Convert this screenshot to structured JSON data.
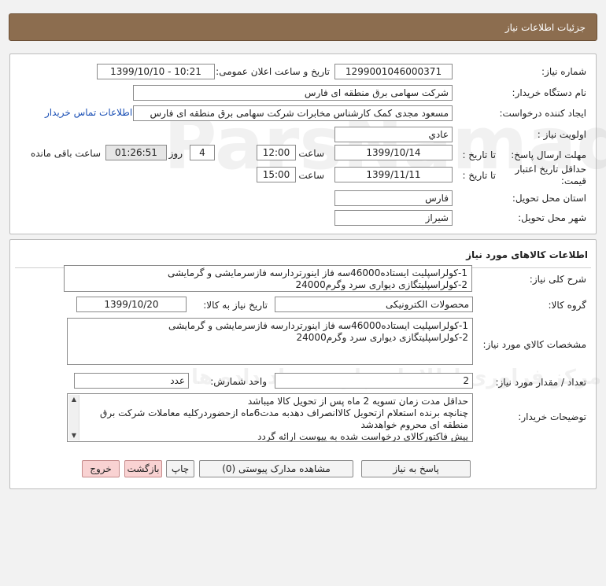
{
  "header": {
    "title": "جزئیات اطلاعات نیاز"
  },
  "info": {
    "need_number_label": "شماره نیاز:",
    "need_number": "1299001046000371",
    "announce_label": "تاریخ و ساعت اعلان عمومی:",
    "announce_value": "1399/10/10 - 10:21",
    "buyer_org_label": "نام دستگاه خریدار:",
    "buyer_org": "شرکت سهامی برق منطقه ای فارس",
    "creator_label": "ایجاد کننده درخواست:",
    "creator": "مسعود مجدی کمک کارشناس مخابرات شرکت سهامی برق منطقه ای فارس",
    "contact_link": "اطلاعات تماس خریدار",
    "priority_label": "اولویت نیاز :",
    "priority": "عادي",
    "deadline_label": "مهلت ارسال پاسخ:",
    "to_date_label": "تا تاریخ :",
    "deadline_date": "1399/10/14",
    "time_label": "ساعت",
    "deadline_time": "12:00",
    "days_value": "4",
    "days_label": "روز و",
    "remaining_time": "01:26:51",
    "remaining_label": "ساعت باقی مانده",
    "validity_label": "حداقل تاریخ اعتبار قیمت:",
    "validity_to_date_label": "تا تاریخ :",
    "validity_date": "1399/11/11",
    "validity_time_label": "ساعت",
    "validity_time": "15:00",
    "province_label": "استان محل تحویل:",
    "province": "فارس",
    "city_label": "شهر محل تحویل:",
    "city": "شیراز"
  },
  "goods": {
    "section_title": "اطلاعات کالاهای مورد نیاز",
    "summary_label": "شرح کلی نیاز:",
    "summary_lines": [
      "1-کولراسپلیت ایستاده46000سه فاز اینورتردارسه فازسرمایشی و گرمایشی",
      "2-کولراسپلیتگازی دیواری سرد وگرم24000"
    ],
    "group_label": "گروه کالا:",
    "group_value": "محصولات الکترونیکی",
    "need_date_label": "تاریخ نیاز به کالا:",
    "need_date": "1399/10/20",
    "specs_label": "مشخصات کالاي مورد نیاز:",
    "specs_lines": [
      "1-کولراسپلیت ایستاده46000سه فاز اینورتردارسه فازسرمایشی و گرمایشی",
      "2-کولراسپلیتگازی دیواری سرد وگرم24000"
    ],
    "qty_label": "تعداد / مقدار مورد نیاز:",
    "qty": "2",
    "unit_label": "واحد شمارش:",
    "unit": "عدد",
    "buyer_notes_label": "توضیحات خریدار:",
    "buyer_notes_lines": [
      "حداقل مدت زمان تسویه 2 ماه پس از تحویل کالا میباشد",
      "چنانچه برنده استعلام ازتحویل کالاانصراف دهدبه مدت6ماه ازحضوردرکلیه معاملات شرکت برق",
      "منطقه ای محروم خواهدشد",
      "پیش فاکتورکالای درخواست شده به پیوست ارائه گردد"
    ]
  },
  "buttons": {
    "reply": "پاسخ به نیاز",
    "attachments": "مشاهده مدارک پیوستی (0)",
    "print": "چاپ",
    "back": "بازگشت",
    "exit": "خروج"
  }
}
